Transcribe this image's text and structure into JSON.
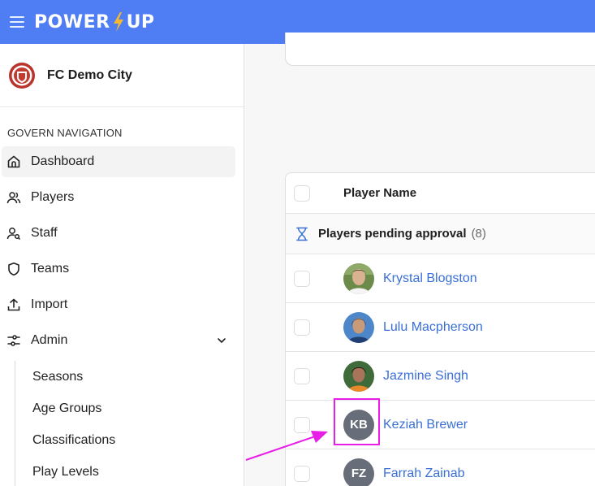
{
  "app": {
    "logo_left": "POWER",
    "logo_right": "UP"
  },
  "sidebar": {
    "club_name": "FC Demo City",
    "nav_title": "GOVERN NAVIGATION",
    "items": [
      {
        "label": "Dashboard",
        "icon": "home-icon",
        "active": true
      },
      {
        "label": "Players",
        "icon": "users-icon"
      },
      {
        "label": "Staff",
        "icon": "user-search-icon"
      },
      {
        "label": "Teams",
        "icon": "shield-icon"
      },
      {
        "label": "Import",
        "icon": "upload-icon"
      },
      {
        "label": "Admin",
        "icon": "sliders-icon",
        "expanded": true
      }
    ],
    "admin_sub_items": [
      "Seasons",
      "Age Groups",
      "Classifications",
      "Play Levels"
    ]
  },
  "table": {
    "header": "Player Name",
    "group_label": "Players pending approval",
    "group_count": "(8)",
    "players": [
      {
        "name": "Krystal Blogston",
        "avatar": "photo"
      },
      {
        "name": "Lulu Macpherson",
        "avatar": "photo"
      },
      {
        "name": "Jazmine Singh",
        "avatar": "photo"
      },
      {
        "name": "Keziah Brewer",
        "avatar": "initials",
        "initials": "KB"
      },
      {
        "name": "Farrah Zainab",
        "avatar": "initials",
        "initials": "FZ"
      }
    ]
  },
  "annotation": {
    "color": "#e81ee8"
  },
  "colors": {
    "topbar": "#4f7ef4",
    "link": "#3a6fd8",
    "bolt": "#f5b82e"
  }
}
